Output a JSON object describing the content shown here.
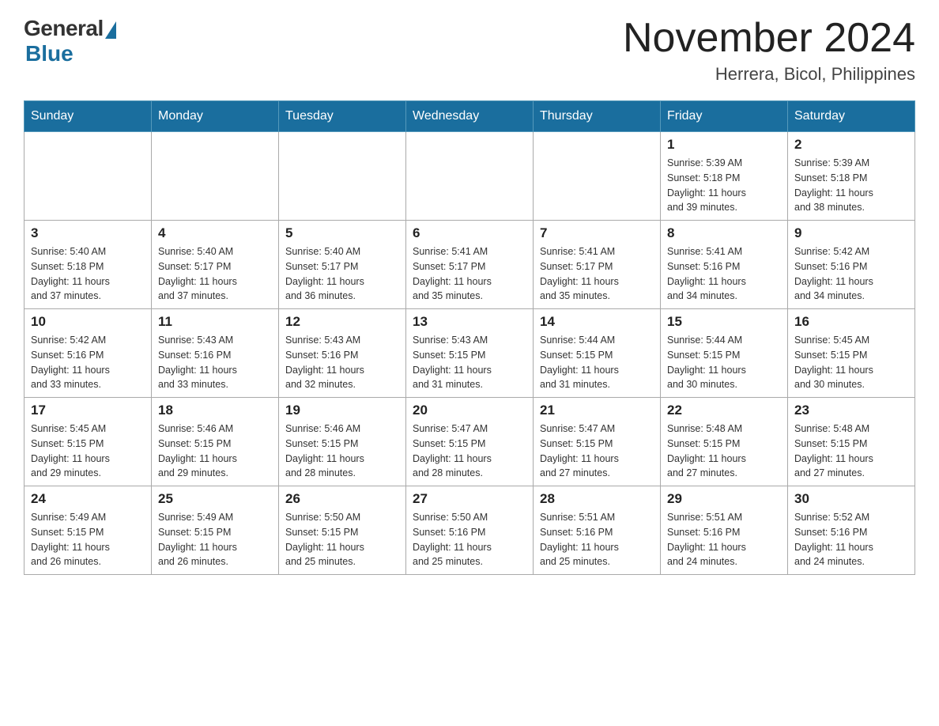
{
  "logo": {
    "general_text": "General",
    "blue_text": "Blue"
  },
  "header": {
    "month_year": "November 2024",
    "location": "Herrera, Bicol, Philippines"
  },
  "days_of_week": [
    "Sunday",
    "Monday",
    "Tuesday",
    "Wednesday",
    "Thursday",
    "Friday",
    "Saturday"
  ],
  "weeks": [
    [
      {
        "day": "",
        "info": ""
      },
      {
        "day": "",
        "info": ""
      },
      {
        "day": "",
        "info": ""
      },
      {
        "day": "",
        "info": ""
      },
      {
        "day": "",
        "info": ""
      },
      {
        "day": "1",
        "info": "Sunrise: 5:39 AM\nSunset: 5:18 PM\nDaylight: 11 hours\nand 39 minutes."
      },
      {
        "day": "2",
        "info": "Sunrise: 5:39 AM\nSunset: 5:18 PM\nDaylight: 11 hours\nand 38 minutes."
      }
    ],
    [
      {
        "day": "3",
        "info": "Sunrise: 5:40 AM\nSunset: 5:18 PM\nDaylight: 11 hours\nand 37 minutes."
      },
      {
        "day": "4",
        "info": "Sunrise: 5:40 AM\nSunset: 5:17 PM\nDaylight: 11 hours\nand 37 minutes."
      },
      {
        "day": "5",
        "info": "Sunrise: 5:40 AM\nSunset: 5:17 PM\nDaylight: 11 hours\nand 36 minutes."
      },
      {
        "day": "6",
        "info": "Sunrise: 5:41 AM\nSunset: 5:17 PM\nDaylight: 11 hours\nand 35 minutes."
      },
      {
        "day": "7",
        "info": "Sunrise: 5:41 AM\nSunset: 5:17 PM\nDaylight: 11 hours\nand 35 minutes."
      },
      {
        "day": "8",
        "info": "Sunrise: 5:41 AM\nSunset: 5:16 PM\nDaylight: 11 hours\nand 34 minutes."
      },
      {
        "day": "9",
        "info": "Sunrise: 5:42 AM\nSunset: 5:16 PM\nDaylight: 11 hours\nand 34 minutes."
      }
    ],
    [
      {
        "day": "10",
        "info": "Sunrise: 5:42 AM\nSunset: 5:16 PM\nDaylight: 11 hours\nand 33 minutes."
      },
      {
        "day": "11",
        "info": "Sunrise: 5:43 AM\nSunset: 5:16 PM\nDaylight: 11 hours\nand 33 minutes."
      },
      {
        "day": "12",
        "info": "Sunrise: 5:43 AM\nSunset: 5:16 PM\nDaylight: 11 hours\nand 32 minutes."
      },
      {
        "day": "13",
        "info": "Sunrise: 5:43 AM\nSunset: 5:15 PM\nDaylight: 11 hours\nand 31 minutes."
      },
      {
        "day": "14",
        "info": "Sunrise: 5:44 AM\nSunset: 5:15 PM\nDaylight: 11 hours\nand 31 minutes."
      },
      {
        "day": "15",
        "info": "Sunrise: 5:44 AM\nSunset: 5:15 PM\nDaylight: 11 hours\nand 30 minutes."
      },
      {
        "day": "16",
        "info": "Sunrise: 5:45 AM\nSunset: 5:15 PM\nDaylight: 11 hours\nand 30 minutes."
      }
    ],
    [
      {
        "day": "17",
        "info": "Sunrise: 5:45 AM\nSunset: 5:15 PM\nDaylight: 11 hours\nand 29 minutes."
      },
      {
        "day": "18",
        "info": "Sunrise: 5:46 AM\nSunset: 5:15 PM\nDaylight: 11 hours\nand 29 minutes."
      },
      {
        "day": "19",
        "info": "Sunrise: 5:46 AM\nSunset: 5:15 PM\nDaylight: 11 hours\nand 28 minutes."
      },
      {
        "day": "20",
        "info": "Sunrise: 5:47 AM\nSunset: 5:15 PM\nDaylight: 11 hours\nand 28 minutes."
      },
      {
        "day": "21",
        "info": "Sunrise: 5:47 AM\nSunset: 5:15 PM\nDaylight: 11 hours\nand 27 minutes."
      },
      {
        "day": "22",
        "info": "Sunrise: 5:48 AM\nSunset: 5:15 PM\nDaylight: 11 hours\nand 27 minutes."
      },
      {
        "day": "23",
        "info": "Sunrise: 5:48 AM\nSunset: 5:15 PM\nDaylight: 11 hours\nand 27 minutes."
      }
    ],
    [
      {
        "day": "24",
        "info": "Sunrise: 5:49 AM\nSunset: 5:15 PM\nDaylight: 11 hours\nand 26 minutes."
      },
      {
        "day": "25",
        "info": "Sunrise: 5:49 AM\nSunset: 5:15 PM\nDaylight: 11 hours\nand 26 minutes."
      },
      {
        "day": "26",
        "info": "Sunrise: 5:50 AM\nSunset: 5:15 PM\nDaylight: 11 hours\nand 25 minutes."
      },
      {
        "day": "27",
        "info": "Sunrise: 5:50 AM\nSunset: 5:16 PM\nDaylight: 11 hours\nand 25 minutes."
      },
      {
        "day": "28",
        "info": "Sunrise: 5:51 AM\nSunset: 5:16 PM\nDaylight: 11 hours\nand 25 minutes."
      },
      {
        "day": "29",
        "info": "Sunrise: 5:51 AM\nSunset: 5:16 PM\nDaylight: 11 hours\nand 24 minutes."
      },
      {
        "day": "30",
        "info": "Sunrise: 5:52 AM\nSunset: 5:16 PM\nDaylight: 11 hours\nand 24 minutes."
      }
    ]
  ]
}
